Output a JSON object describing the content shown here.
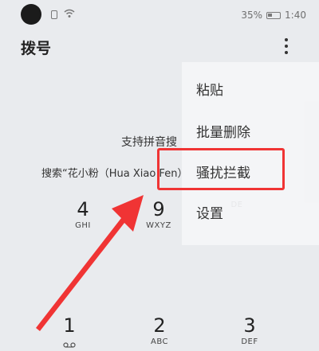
{
  "status": {
    "battery": "35%",
    "time": "1:40"
  },
  "header": {
    "title": "拨号"
  },
  "search": {
    "hint": "支持拼音搜",
    "prefix": "搜索“花小粉（",
    "pinyin": "Hua Xiao Fen",
    "suffix": "）"
  },
  "menu": {
    "items": [
      "粘贴",
      "批量删除",
      "骚扰拦截",
      "设置"
    ]
  },
  "dialpad": {
    "keys": [
      {
        "number": "4",
        "letters": "GHI"
      },
      {
        "number": "9",
        "letters": "WXYZ"
      },
      {
        "number": "",
        "letters": "DE"
      },
      {
        "number": "1",
        "letters": ""
      },
      {
        "number": "2",
        "letters": "ABC"
      },
      {
        "number": "3",
        "letters": "DEF"
      }
    ]
  },
  "colors": {
    "annotation_red": "#f03434",
    "background": "#e9ebee"
  }
}
